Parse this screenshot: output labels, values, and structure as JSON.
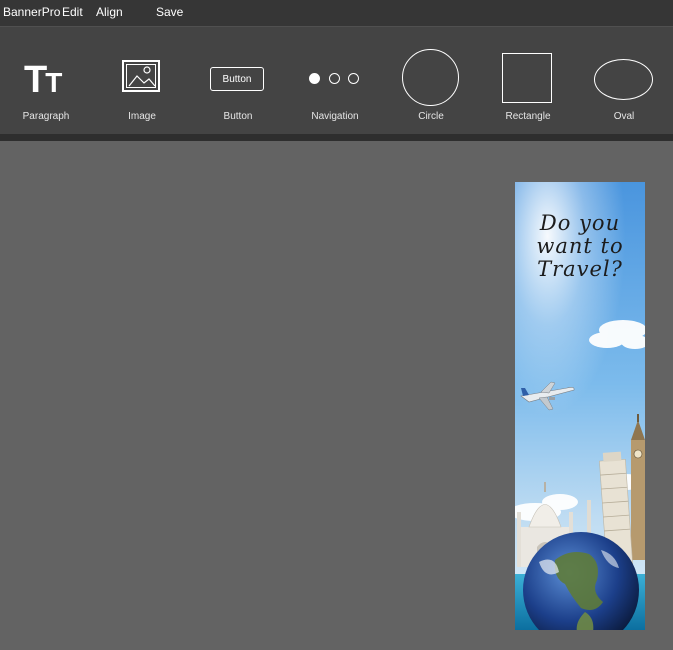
{
  "menubar": {
    "app_name": "BannerPro",
    "items": [
      "Edit",
      "Align"
    ],
    "save_label": "Save"
  },
  "toolbar": {
    "tools": [
      {
        "label": "Paragraph",
        "icon": "text-tt-icon"
      },
      {
        "label": "Image",
        "icon": "image-icon"
      },
      {
        "label": "Button",
        "icon": "button-icon",
        "icon_text": "Button"
      },
      {
        "label": "Navigation",
        "icon": "navigation-dots-icon"
      },
      {
        "label": "Circle",
        "icon": "circle-icon"
      },
      {
        "label": "Rectangle",
        "icon": "rectangle-icon"
      },
      {
        "label": "Oval",
        "icon": "oval-icon"
      }
    ],
    "paragraph_icon_text": {
      "big": "T",
      "small": "T"
    }
  },
  "canvas": {
    "background_color": "#636363",
    "banner": {
      "headline": "Do you\nwant to\nTravel?",
      "image_description": "travel-landmarks-globe-airplane"
    }
  },
  "colors": {
    "menubar": "#363636",
    "toolbar": "#444444",
    "sky_top": "#4e9be0",
    "sky_bottom": "#cfe6f5"
  }
}
